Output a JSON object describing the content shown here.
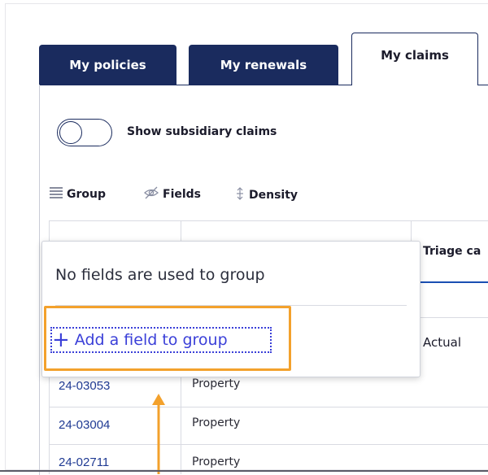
{
  "tabs": [
    {
      "label": "My policies",
      "active": false
    },
    {
      "label": "My renewals",
      "active": false
    },
    {
      "label": "My claims",
      "active": true
    }
  ],
  "toggle": {
    "label": "Show subsidiary claims",
    "on": false
  },
  "toolbar": {
    "group_label": "Group",
    "group_icon": "list-lines-icon",
    "fields_label": "Fields",
    "fields_icon": "eye-slash-icon",
    "density_label": "Density",
    "density_icon": "updown-arrows-icon"
  },
  "table": {
    "partial_header": "Triage ca",
    "partial_cell": "Actual",
    "rows": [
      {
        "id": "24-03053",
        "type": "Property"
      },
      {
        "id": "24-03004",
        "type": "Property"
      },
      {
        "id": "24-02711",
        "type": "Property"
      }
    ]
  },
  "group_popup": {
    "message": "No fields are used to group",
    "add_label": "Add a field to group"
  },
  "colors": {
    "brand_navy": "#1a2b5e",
    "link_blue": "#1f3a93",
    "highlight_orange": "#f3a12c",
    "focus_blue": "#3a3fd8"
  }
}
